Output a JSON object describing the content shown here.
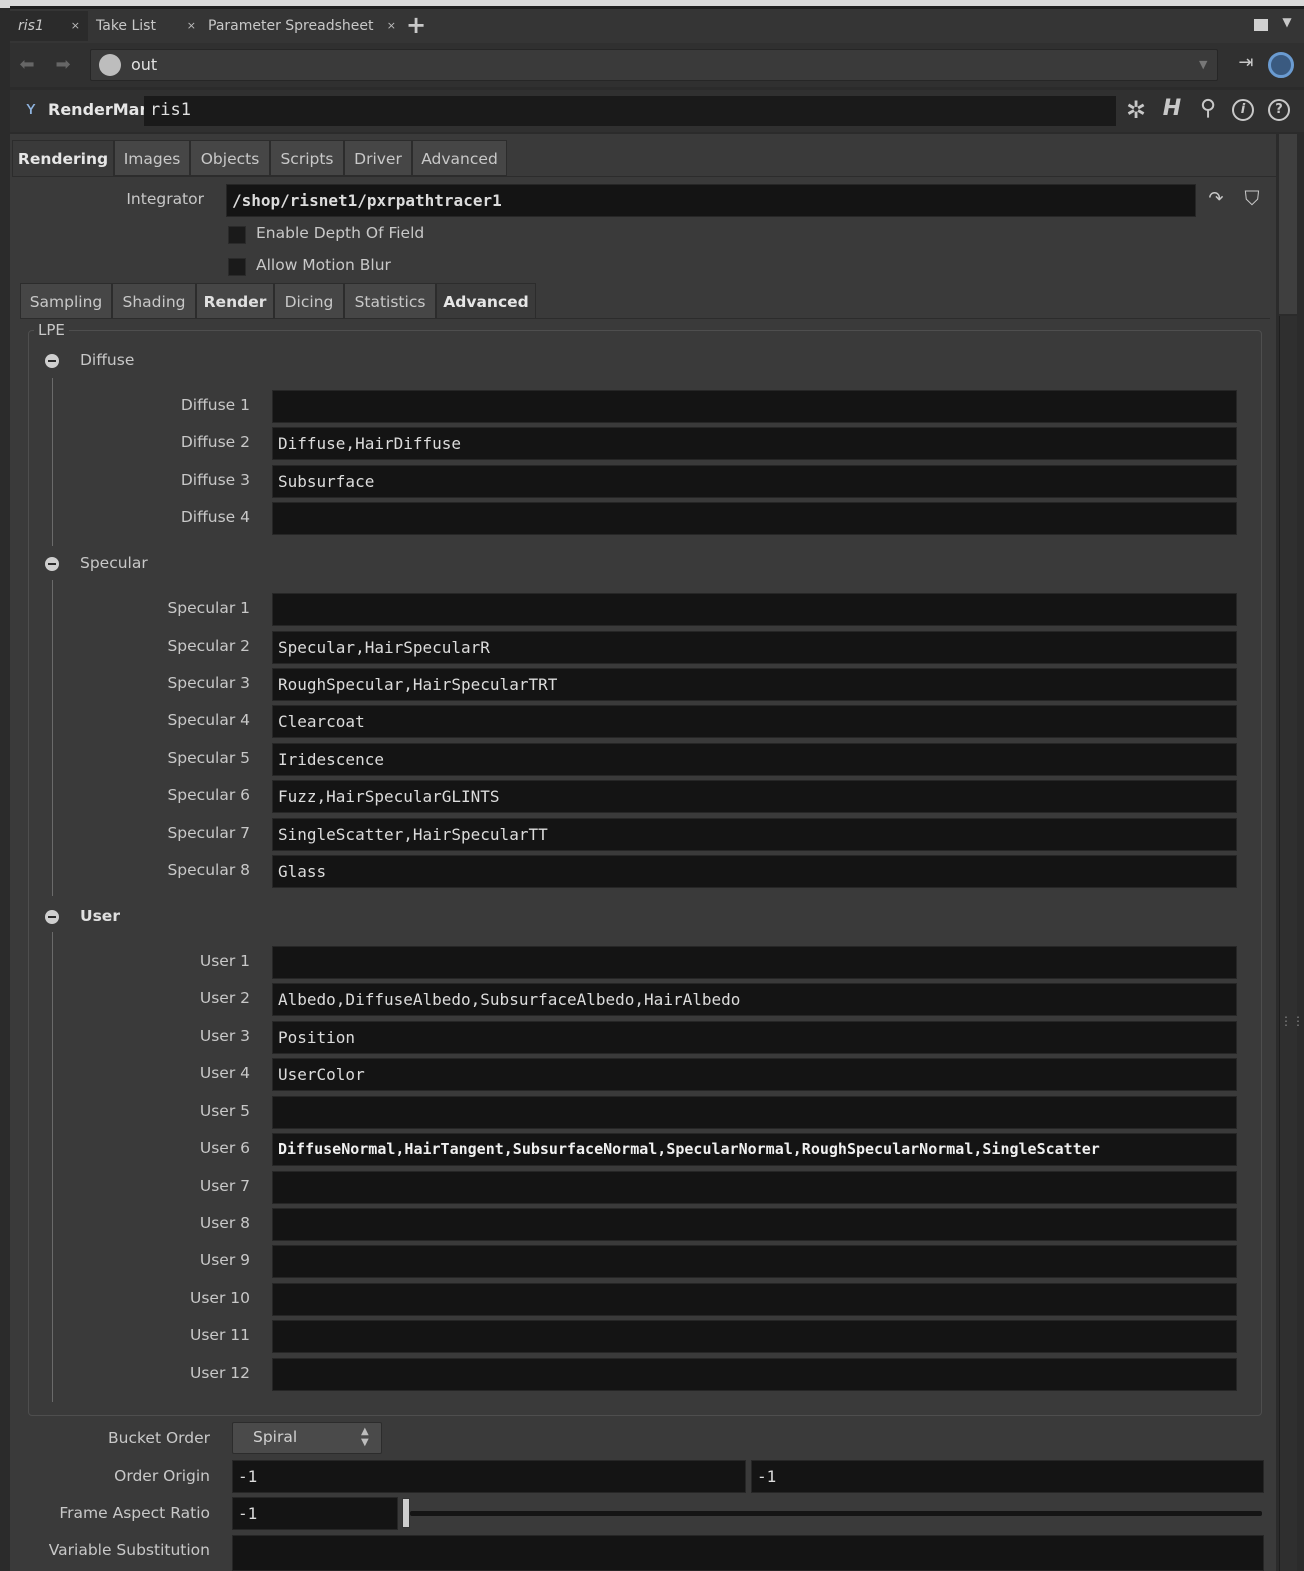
{
  "pane_tabs": [
    {
      "label": "ris1",
      "close": "×"
    },
    {
      "label": "Take List",
      "close": "×"
    },
    {
      "label": "Parameter Spreadsheet",
      "close": "×"
    }
  ],
  "add_tab": "+",
  "path": {
    "value": "out"
  },
  "node": {
    "type": "RenderMan",
    "name": "ris1"
  },
  "main_tabs": [
    "Rendering",
    "Images",
    "Objects",
    "Scripts",
    "Driver",
    "Advanced"
  ],
  "integrator": {
    "label": "Integrator",
    "value": "/shop/risnet1/pxrpathtracer1"
  },
  "checkboxes": [
    {
      "label": "Enable Depth Of Field",
      "checked": false
    },
    {
      "label": "Allow Motion Blur",
      "checked": false
    }
  ],
  "sub_tabs": [
    "Sampling",
    "Shading",
    "Render",
    "Dicing",
    "Statistics",
    "Advanced"
  ],
  "lpe": {
    "title": "LPE",
    "diffuse": {
      "title": "Diffuse",
      "rows": [
        {
          "label": "Diffuse 1",
          "value": ""
        },
        {
          "label": "Diffuse 2",
          "value": "Diffuse,HairDiffuse"
        },
        {
          "label": "Diffuse 3",
          "value": "Subsurface"
        },
        {
          "label": "Diffuse 4",
          "value": ""
        }
      ]
    },
    "specular": {
      "title": "Specular",
      "rows": [
        {
          "label": "Specular 1",
          "value": ""
        },
        {
          "label": "Specular 2",
          "value": "Specular,HairSpecularR"
        },
        {
          "label": "Specular 3",
          "value": "RoughSpecular,HairSpecularTRT"
        },
        {
          "label": "Specular 4",
          "value": "Clearcoat"
        },
        {
          "label": "Specular 5",
          "value": "Iridescence"
        },
        {
          "label": "Specular 6",
          "value": "Fuzz,HairSpecularGLINTS"
        },
        {
          "label": "Specular 7",
          "value": "SingleScatter,HairSpecularTT"
        },
        {
          "label": "Specular 8",
          "value": "Glass"
        }
      ]
    },
    "user": {
      "title": "User",
      "rows": [
        {
          "label": "User 1",
          "value": ""
        },
        {
          "label": "User 2",
          "value": "Albedo,DiffuseAlbedo,SubsurfaceAlbedo,HairAlbedo"
        },
        {
          "label": "User 3",
          "value": "Position"
        },
        {
          "label": "User 4",
          "value": "UserColor"
        },
        {
          "label": "User 5",
          "value": ""
        },
        {
          "label": "User 6",
          "value": "DiffuseNormal,HairTangent,SubsurfaceNormal,SpecularNormal,RoughSpecularNormal,SingleScatter"
        },
        {
          "label": "User 7",
          "value": ""
        },
        {
          "label": "User 8",
          "value": ""
        },
        {
          "label": "User 9",
          "value": ""
        },
        {
          "label": "User 10",
          "value": ""
        },
        {
          "label": "User 11",
          "value": ""
        },
        {
          "label": "User 12",
          "value": ""
        }
      ]
    }
  },
  "bucket_order": {
    "label": "Bucket Order",
    "value": "Spiral"
  },
  "order_origin": {
    "label": "Order Origin",
    "x": "-1",
    "y": "-1"
  },
  "frame_aspect": {
    "label": "Frame Aspect Ratio",
    "value": "-1",
    "slider_fraction": 0
  },
  "variable_substitution": {
    "label": "Variable Substitution",
    "value": ""
  }
}
